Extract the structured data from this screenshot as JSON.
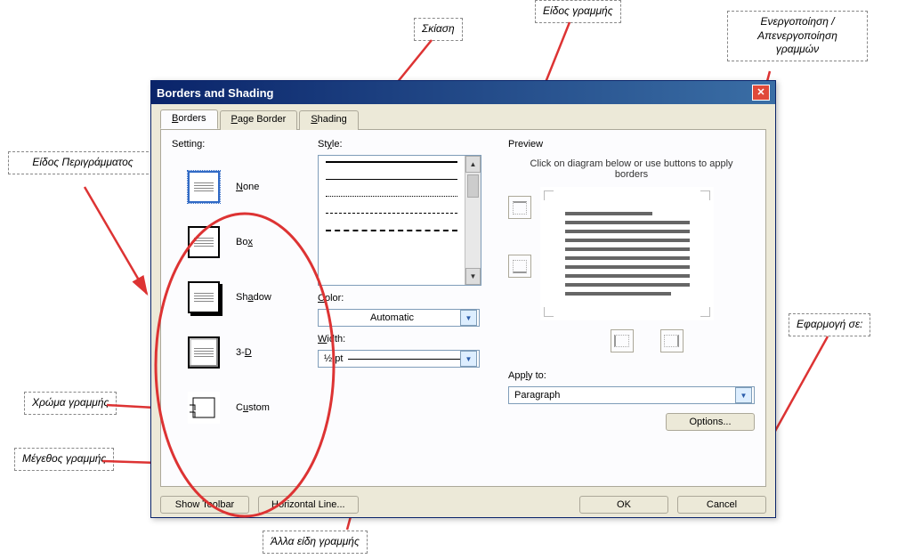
{
  "callouts": {
    "skiasi": "Σκίαση",
    "eidos_grammis": "Είδος γραμμής",
    "energopoiisi": "Ενεργοποίηση / Απενεργοποίηση γραμμών",
    "eidos_perigrammatos": "Είδος Περιγράμματος",
    "xroma_grammis": "Χρώμα γραμμής",
    "megethos_grammis": "Μέγεθος γραμμής",
    "alla_eidi": "Άλλα είδη γραμμής",
    "efarmogi_se": "Εφαρμογή σε:"
  },
  "dialog": {
    "title": "Borders and Shading",
    "tabs": {
      "borders": "Borders",
      "page_border": "Page Border",
      "shading": "Shading"
    },
    "setting_label": "Setting:",
    "settings": {
      "none": "None",
      "box": "Box",
      "shadow": "Shadow",
      "threed": "3-D",
      "custom": "Custom"
    },
    "style_label": "Style:",
    "color_label": "Color:",
    "color_value": "Automatic",
    "width_label": "Width:",
    "width_value": "½ pt",
    "preview_label": "Preview",
    "preview_hint": "Click on diagram below or use buttons to apply borders",
    "apply_to_label": "Apply to:",
    "apply_to_value": "Paragraph",
    "options": "Options...",
    "show_toolbar": "Show Toolbar",
    "horizontal_line": "Horizontal Line...",
    "ok": "OK",
    "cancel": "Cancel"
  }
}
